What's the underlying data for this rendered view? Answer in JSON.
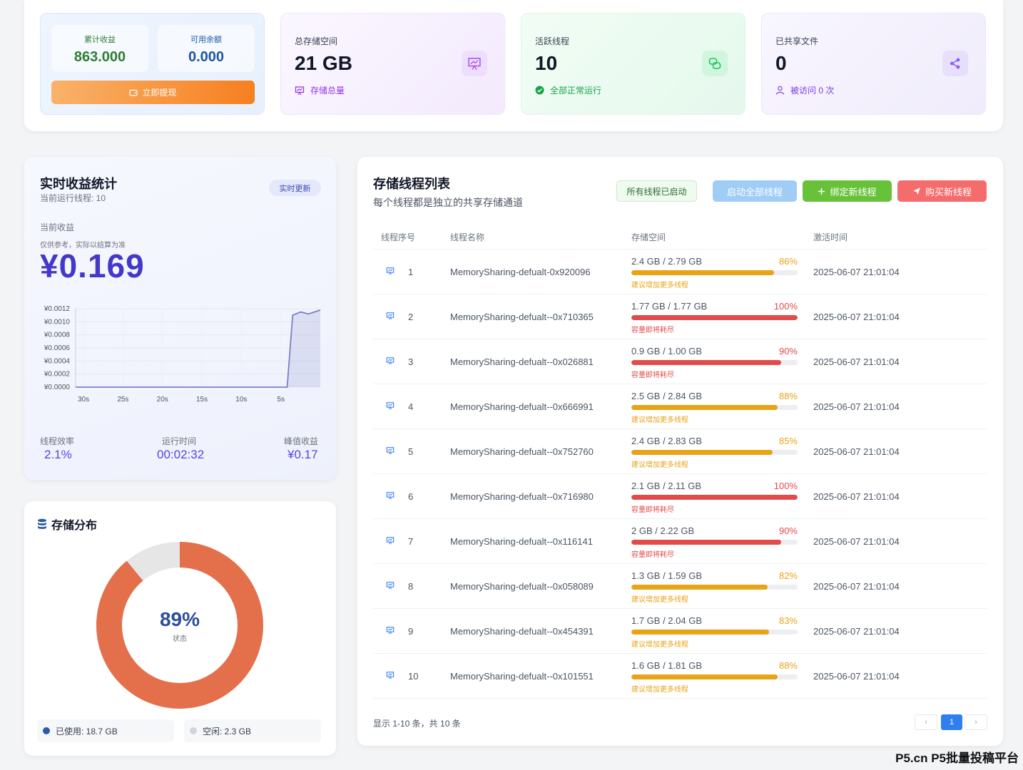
{
  "earnings_card": {
    "cumulative_label": "累计收益",
    "cumulative_value": "863.000",
    "balance_label": "可用余额",
    "balance_value": "0.000",
    "withdraw_label": "立即提现"
  },
  "storage_card": {
    "label": "总存储空间",
    "value": "21 GB",
    "sub": "存储总量",
    "icon": "presentation-icon"
  },
  "threads_card": {
    "label": "活跃线程",
    "value": "10",
    "sub": "全部正常运行",
    "icon": "link-icon"
  },
  "shared_card": {
    "label": "已共享文件",
    "value": "0",
    "sub": "被访问 0 次",
    "icon": "share-icon"
  },
  "realtime": {
    "title": "实时收益统计",
    "subtitle": "当前运行线程: 10",
    "badge": "实时更新",
    "current_label": "当前收益",
    "note": "仅供参考，实际以结算为准",
    "current_value": "¥0.169",
    "stats": [
      {
        "label": "线程效率",
        "value": "2.1%"
      },
      {
        "label": "运行时间",
        "value": "00:02:32"
      },
      {
        "label": "峰值收益",
        "value": "¥0.17"
      }
    ]
  },
  "chart_data": {
    "type": "area",
    "x": [
      "30s",
      "25s",
      "20s",
      "15s",
      "10s",
      "5s"
    ],
    "y_ticks": [
      "¥0.0012",
      "¥0.0010",
      "¥0.0008",
      "¥0.0006",
      "¥0.0004",
      "¥0.0002",
      "¥0.0000"
    ],
    "ylim": [
      0,
      0.0012
    ],
    "xlim": [
      31,
      0
    ],
    "points": [
      [
        31,
        0
      ],
      [
        27,
        0
      ],
      [
        23,
        0
      ],
      [
        19,
        0
      ],
      [
        15,
        0
      ],
      [
        11,
        0
      ],
      [
        7,
        0
      ],
      [
        4.2,
        0
      ],
      [
        3.5,
        0.0011
      ],
      [
        2.5,
        0.00115
      ],
      [
        1.5,
        0.00112
      ],
      [
        0,
        0.00118
      ]
    ],
    "color": "#7c7fc8",
    "grid": true
  },
  "distribution": {
    "title": "存储分布",
    "percent": "89%",
    "state_label": "状态",
    "used_fraction": 0.89,
    "used_color": "#e4704b",
    "free_color": "#e6e6e6",
    "legend": [
      {
        "label": "已使用: 18.7 GB",
        "color": "#2c5aa8"
      },
      {
        "label": "空闲: 2.3 GB",
        "color": "#d1d5db"
      }
    ]
  },
  "thread_list": {
    "title": "存储线程列表",
    "subtitle": "每个线程都是独立的共享存储通道",
    "status_label": "所有线程已启动",
    "btn_start_all": "启动全部线程",
    "btn_bind": "绑定新线程",
    "btn_buy": "购买新线程",
    "columns": [
      "线程序号",
      "线程名称",
      "存储空间",
      "激活时间"
    ],
    "rows": [
      {
        "no": "1",
        "name": "MemorySharing-defualt-0x920096",
        "cap": "2.4 GB / 2.79 GB",
        "pct": "86%",
        "fill": 0.86,
        "tip": "建议增加更多线程",
        "level": "warn",
        "time": "2025-06-07 21:01:04"
      },
      {
        "no": "2",
        "name": "MemorySharing-defualt--0x710365",
        "cap": "1.77 GB / 1.77 GB",
        "pct": "100%",
        "fill": 1.0,
        "tip": "容量即将耗尽",
        "level": "danger",
        "time": "2025-06-07 21:01:04"
      },
      {
        "no": "3",
        "name": "MemorySharing-defualt--0x026881",
        "cap": "0.9 GB / 1.00 GB",
        "pct": "90%",
        "fill": 0.9,
        "tip": "容量即将耗尽",
        "level": "danger",
        "time": "2025-06-07 21:01:04"
      },
      {
        "no": "4",
        "name": "MemorySharing-defualt--0x666991",
        "cap": "2.5 GB / 2.84 GB",
        "pct": "88%",
        "fill": 0.88,
        "tip": "建议增加更多线程",
        "level": "warn",
        "time": "2025-06-07 21:01:04"
      },
      {
        "no": "5",
        "name": "MemorySharing-defualt--0x752760",
        "cap": "2.4 GB / 2.83 GB",
        "pct": "85%",
        "fill": 0.85,
        "tip": "建议增加更多线程",
        "level": "warn",
        "time": "2025-06-07 21:01:04"
      },
      {
        "no": "6",
        "name": "MemorySharing-defualt--0x716980",
        "cap": "2.1 GB / 2.11 GB",
        "pct": "100%",
        "fill": 1.0,
        "tip": "容量即将耗尽",
        "level": "danger",
        "time": "2025-06-07 21:01:04"
      },
      {
        "no": "7",
        "name": "MemorySharing-defualt--0x116141",
        "cap": "2 GB / 2.22 GB",
        "pct": "90%",
        "fill": 0.9,
        "tip": "容量即将耗尽",
        "level": "danger",
        "time": "2025-06-07 21:01:04"
      },
      {
        "no": "8",
        "name": "MemorySharing-defualt--0x058089",
        "cap": "1.3 GB / 1.59 GB",
        "pct": "82%",
        "fill": 0.82,
        "tip": "建议增加更多线程",
        "level": "warn",
        "time": "2025-06-07 21:01:04"
      },
      {
        "no": "9",
        "name": "MemorySharing-defualt--0x454391",
        "cap": "1.7 GB / 2.04 GB",
        "pct": "83%",
        "fill": 0.83,
        "tip": "建议增加更多线程",
        "level": "warn",
        "time": "2025-06-07 21:01:04"
      },
      {
        "no": "10",
        "name": "MemorySharing-defualt--0x101551",
        "cap": "1.6 GB / 1.81 GB",
        "pct": "88%",
        "fill": 0.88,
        "tip": "建议增加更多线程",
        "level": "warn",
        "time": "2025-06-07 21:01:04"
      }
    ],
    "footer": "显示 1-10 条，共 10 条",
    "pager": {
      "prev": "‹",
      "current": "1",
      "next": "›"
    },
    "colors": {
      "warn": "#e8a317",
      "danger": "#e34b4b"
    }
  },
  "watermark": "P5.cn P5批量投稿平台"
}
